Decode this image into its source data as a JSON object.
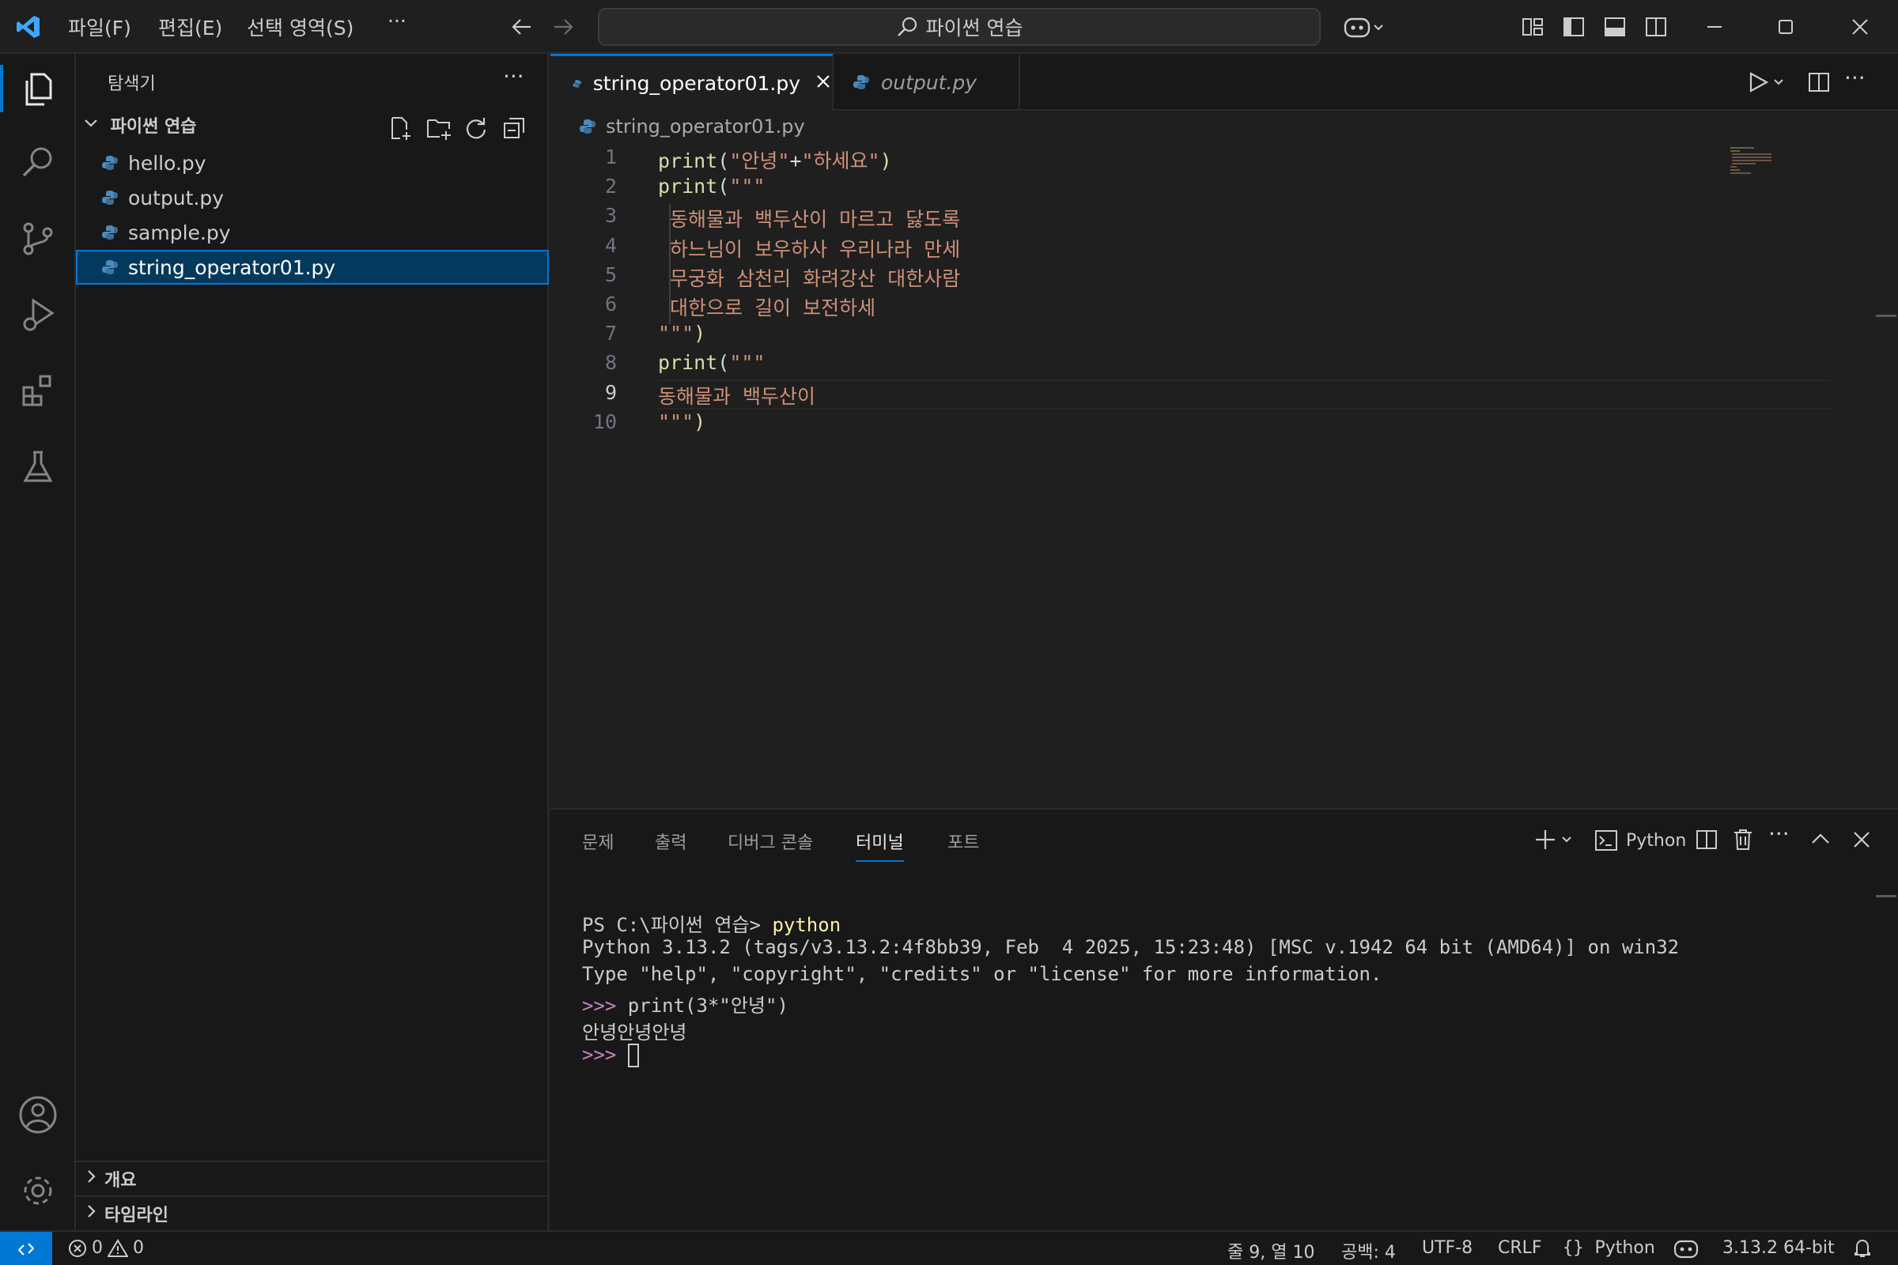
{
  "titlebar": {
    "menus": [
      "파일(F)",
      "편집(E)",
      "선택 영역(S)"
    ],
    "more": "···",
    "search_text": "파이썬 연습"
  },
  "sidebar": {
    "title": "탐색기",
    "more": "···",
    "folder": "파이썬 연습",
    "files": [
      "hello.py",
      "output.py",
      "sample.py",
      "string_operator01.py"
    ],
    "selected": "string_operator01.py",
    "sections": [
      "개요",
      "타임라인"
    ]
  },
  "tabs": [
    {
      "label": "string_operator01.py",
      "active": true
    },
    {
      "label": "output.py",
      "active": false
    }
  ],
  "breadcrumb": "string_operator01.py",
  "editor": {
    "current_line": 9,
    "lines": [
      {
        "n": "1",
        "parts": [
          [
            "kw",
            "print"
          ],
          [
            "op",
            "("
          ],
          [
            "str",
            "\"안녕\""
          ],
          [
            "op",
            "+"
          ],
          [
            "str",
            "\"하세요\""
          ],
          [
            "kw",
            ")"
          ]
        ]
      },
      {
        "n": "2",
        "parts": [
          [
            "kw",
            "print"
          ],
          [
            "op",
            "("
          ],
          [
            "str",
            "\"\"\""
          ]
        ]
      },
      {
        "n": "3",
        "parts": [
          [
            "str",
            " 동해물과 백두산이 마르고 닳도록"
          ]
        ]
      },
      {
        "n": "4",
        "parts": [
          [
            "str",
            " 하느님이 보우하사 우리나라 만세"
          ]
        ]
      },
      {
        "n": "5",
        "parts": [
          [
            "str",
            " 무궁화 삼천리 화려강산 대한사람"
          ]
        ]
      },
      {
        "n": "6",
        "parts": [
          [
            "str",
            " 대한으로 길이 보전하세"
          ]
        ]
      },
      {
        "n": "7",
        "parts": [
          [
            "str",
            "\"\"\""
          ],
          [
            "kw",
            ")"
          ]
        ]
      },
      {
        "n": "8",
        "parts": [
          [
            "kw",
            "print"
          ],
          [
            "op",
            "("
          ],
          [
            "str",
            "\"\"\""
          ]
        ]
      },
      {
        "n": "9",
        "parts": [
          [
            "str",
            "동해물과 백두산이"
          ]
        ]
      },
      {
        "n": "10",
        "parts": [
          [
            "str",
            "\"\"\""
          ],
          [
            "kw",
            ")"
          ]
        ]
      }
    ]
  },
  "panel": {
    "tabs": [
      "문제",
      "출력",
      "디버그 콘솔",
      "터미널",
      "포트"
    ],
    "active_tab": "터미널",
    "terminal_name": "Python",
    "more": "···",
    "terminal": {
      "ps_prompt": "PS C:\\파이썬 연습> ",
      "ps_cmd": "python",
      "version_line": "Python 3.13.2 (tags/v3.13.2:4f8bb39, Feb  4 2025, 15:23:48) [MSC v.1942 64 bit (AMD64)] on win32",
      "help_line": "Type \"help\", \"copyright\", \"credits\" or \"license\" for more information.",
      "repl_prompt": ">>> ",
      "repl_cmd": "print(3*\"안녕\")",
      "output": "안녕안녕안녕",
      "repl_prompt2": ">>> "
    }
  },
  "statusbar": {
    "errors": "0",
    "warnings": "0",
    "position": "줄 9, 열 10",
    "spaces": "공백: 4",
    "encoding": "UTF-8",
    "eol": "CRLF",
    "language": "Python",
    "interpreter": "3.13.2 64-bit"
  },
  "colors": {
    "accent": "#0078d4",
    "keyword": "#dcdcaa",
    "string": "#ce9178",
    "python_blue": "#4b8bbe",
    "python_yellow": "#ffd43b"
  }
}
